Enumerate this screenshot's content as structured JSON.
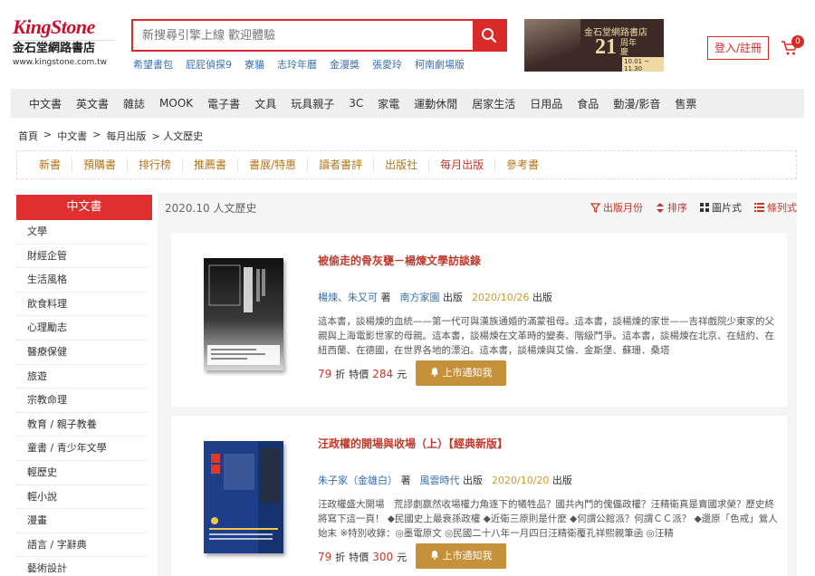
{
  "header": {
    "logo_en_a": "King",
    "logo_en_b": "Stone",
    "logo_zh": "金石堂網路書店",
    "logo_url": "www.kingstone.com.tw",
    "search_placeholder": "新搜尋引擎上線 歡迎體驗",
    "hot_keywords": [
      "希望書包",
      "屁屁偵探9",
      "寮貓",
      "志玲年曆",
      "金漫獎",
      "張愛玲",
      "柯南劇場版"
    ],
    "banner": {
      "title": "金石堂網路書店",
      "number": "21",
      "suffix": "周年慶",
      "dates": "10.01 ~ 11.30"
    },
    "login_label": "登入/註冊",
    "cart_count": "0"
  },
  "main_nav": [
    "中文書",
    "英文書",
    "雜誌",
    "MOOK",
    "電子書",
    "文具",
    "玩具親子",
    "3C",
    "家電",
    "運動休閒",
    "居家生活",
    "日用品",
    "食品",
    "動漫/影音",
    "售票"
  ],
  "breadcrumb": [
    "首頁",
    ">",
    "中文書",
    ">",
    "每月出版",
    "> 人文歷史"
  ],
  "sub_nav": [
    "新書",
    "預購書",
    "排行榜",
    "推薦書",
    "書展/特惠",
    "讀者書評",
    "出版社",
    "每月出版",
    "參考書"
  ],
  "sidebar": {
    "title": "中文書",
    "items": [
      "文學",
      "財經企管",
      "生活風格",
      "飲食料理",
      "心理勵志",
      "醫療保健",
      "旅遊",
      "宗教命理",
      "教育 / 親子教養",
      "童書 / 青少年文學",
      "輕歷史",
      "輕小說",
      "漫畫",
      "語言 / 字辭典",
      "藝術設計"
    ]
  },
  "content": {
    "title": "2020.10 人文歷史",
    "tools": {
      "month": "出版月份",
      "sort": "排序",
      "grid": "圖片式",
      "list": "條列式"
    },
    "products": [
      {
        "title": "被偷走的骨灰甕－楊煉文學訪談錄",
        "author": "楊煉、朱又可",
        "author_suffix": "著",
        "publisher": "南方家園",
        "publisher_suffix": "出版",
        "date": "2020/10/26",
        "date_suffix": "出版",
        "desc": "這本書，談楊煉的血統——第一代可與漢族通婚的滿蒙祖母。這本書，談楊煉的家世——吉祥戲院少東家的父親與上海電影世家的母親。這本書，談楊煉在文革時的變奏、階級鬥爭。這本書，談楊煉在北京、在紐約、在紐西蘭、在德國，在世界各地的漂泊。這本書，談楊煉與艾倫．金斯堡、蘇珊．桑塔",
        "discount": "79",
        "discount_suffix": "折",
        "price_label": "特價",
        "price": "284",
        "price_suffix": "元",
        "notify_label": "上市通知我"
      },
      {
        "title": "汪政權的開場與收場（上）【經典新版】",
        "author": "朱子家（金雄白）",
        "author_suffix": "著",
        "publisher": "風雲時代",
        "publisher_suffix": "出版",
        "date": "2020/10/20",
        "date_suffix": "出版",
        "desc": "汪政權盛大開場　荒謬劇嬴然收場權力角逐下的犧牲品？國共內鬥的傀儡政權？汪精衛真是賣國求榮？歷史終將寫下這一頁！ ◆民國史上最衰孫政權 ◆近衛三原則是什麼 ◆何謂公館派？何謂ＣＣ派？ ◆還原「色戒」鶯人始末 ※特別收錄：◎墨電原文 ◎民國二十八年一月四日汪精衛覆孔祥熙親筆函 ◎汪精",
        "discount": "79",
        "discount_suffix": "折",
        "price_label": "特價",
        "price": "300",
        "price_suffix": "元",
        "notify_label": "上市通知我"
      }
    ]
  },
  "colors": {
    "brand": "#d92a27",
    "gold": "#c5913a",
    "link": "#3a6fb0"
  }
}
